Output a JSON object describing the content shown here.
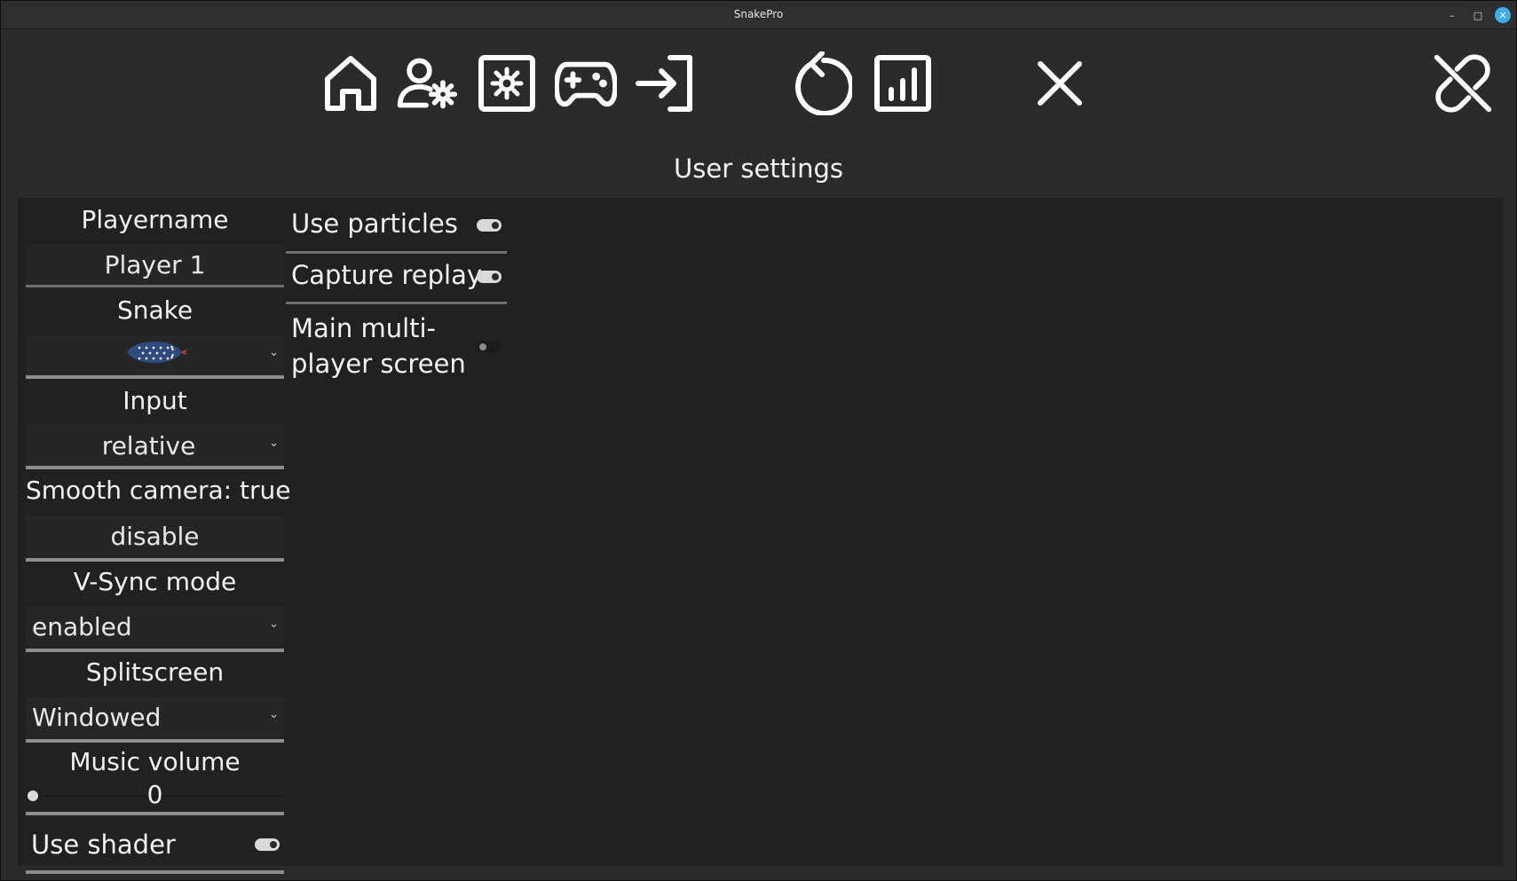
{
  "window": {
    "title": "SnakePro",
    "minimize_glyph": "–",
    "maximize_glyph": "□",
    "close_glyph": "✕"
  },
  "toolbar": {
    "icons": [
      "home-icon",
      "user-settings-icon",
      "settings-icon",
      "gamepad-icon",
      "login-icon",
      "restart-icon",
      "stats-icon",
      "close-icon",
      "link-off-icon"
    ]
  },
  "page": {
    "heading": "User settings"
  },
  "settings": {
    "playername": {
      "label": "Playername",
      "value": "Player 1"
    },
    "snake": {
      "label": "Snake",
      "selected_icon": "snake-skin-icon"
    },
    "input": {
      "label": "Input",
      "value": "relative"
    },
    "smooth_camera": {
      "label": "Smooth camera: true",
      "button": "disable"
    },
    "vsync": {
      "label": "V-Sync mode",
      "value": "enabled"
    },
    "splitscreen": {
      "label": "Splitscreen",
      "value": "Windowed"
    },
    "music_volume": {
      "label": "Music volume",
      "value": "0",
      "level": 0
    },
    "use_shader": {
      "label": "Use shader",
      "on": true
    }
  },
  "options": {
    "use_particles": {
      "label": "Use particles",
      "on": true
    },
    "capture_replay": {
      "label": "Capture replay",
      "on": true
    },
    "main_multiplayer": {
      "label_line1": "Main multi-",
      "label_line2": "player screen",
      "on": false
    }
  },
  "colors": {
    "accent": "#3daee9",
    "background": "#2b2b2b",
    "panel": "#212121",
    "snake_body": "#2f4a7c"
  }
}
